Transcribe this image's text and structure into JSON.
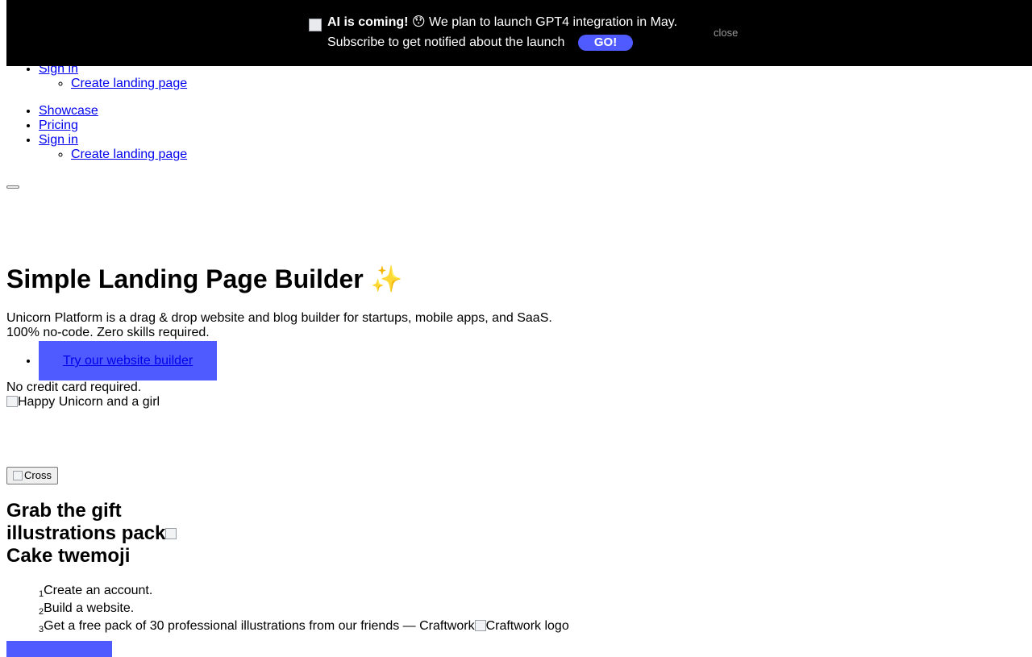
{
  "banner": {
    "headline": "AI is coming!",
    "emoji": "😯",
    "message": "We plan to launch GPT4 integration in May.",
    "subscribe_text": "Subscribe to get notified about the launch",
    "go_label": "GO!",
    "close_label": "close",
    "background": "#000000",
    "accent": "#4f5bff"
  },
  "nav_top": {
    "sign_in": "Sign in",
    "create_landing": "Create landing page"
  },
  "nav": {
    "items": [
      "Showcase",
      "Pricing",
      "Sign in"
    ],
    "create_landing": "Create landing page"
  },
  "hero": {
    "title": "Simple Landing Page Builder",
    "title_emoji": "✨",
    "subtitle_line1": "Unicorn Platform is a drag & drop website and blog builder for startups, mobile apps, and SaaS.",
    "subtitle_line2": "100% no-code. Zero skills required.",
    "cta_label": "Try our website builder",
    "no_card": "No credit card required.",
    "image_alt": "Happy Unicorn and a girl"
  },
  "gift": {
    "cross_alt": "Cross",
    "title": "Grab the gift illustrations pack",
    "cake_alt": "Cake twemoji",
    "steps": [
      {
        "num": "1",
        "text": "Create an account."
      },
      {
        "num": "2",
        "text": "Build a website."
      },
      {
        "num": "3",
        "text": "Get a free pack of 30 professional illustrations from our friends — Craftwork",
        "logo_alt": "Craftwork logo"
      }
    ]
  }
}
